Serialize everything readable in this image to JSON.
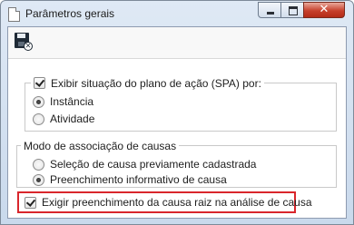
{
  "window": {
    "title": "Parâmetros gerais",
    "close_glyph": "✕"
  },
  "toolbar": {
    "save_icon": "save-close-icon",
    "save_badge": "✕"
  },
  "spa_group": {
    "legend_label": "Exibir situação do plano de ação (SPA) por:",
    "legend_checked": true,
    "options": [
      {
        "label": "Instância",
        "selected": true
      },
      {
        "label": "Atividade",
        "selected": false
      }
    ]
  },
  "cause_group": {
    "legend_label": "Modo de associação de causas",
    "options": [
      {
        "label": "Seleção de causa previamente cadastrada",
        "selected": false
      },
      {
        "label": "Preenchimento informativo de causa",
        "selected": true
      }
    ]
  },
  "root_cause": {
    "label": "Exigir preenchimento da causa raiz na análise de causa",
    "checked": true
  },
  "colors": {
    "highlight": "#d9262c",
    "close_button": "#c7402c"
  }
}
